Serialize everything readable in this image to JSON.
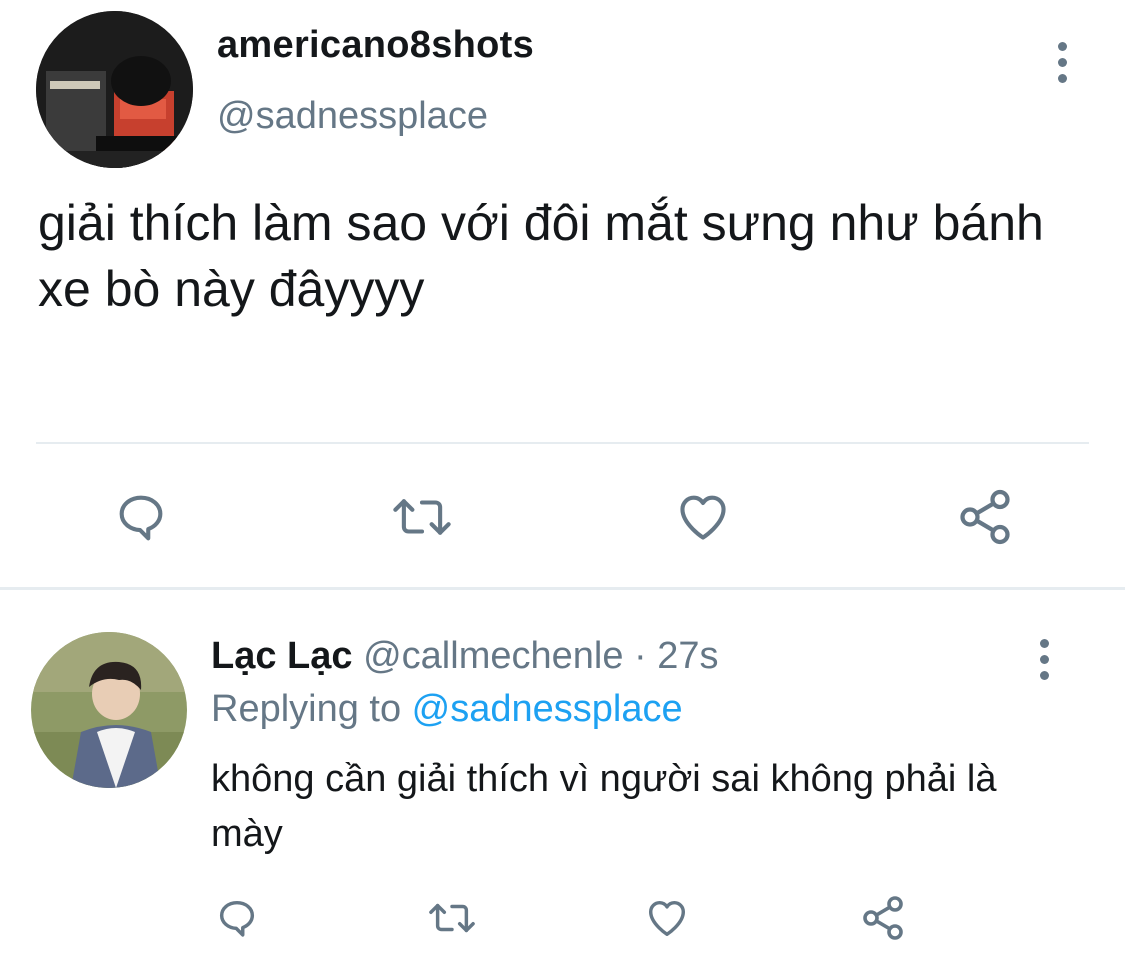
{
  "main_tweet": {
    "display_name": "americano8shots",
    "handle": "@sadnessplace",
    "text": "giải thích làm sao với đôi mắt sưng như bánh xe bò này đâyyyy",
    "actions": [
      "comment-icon",
      "retweet-icon",
      "heart-icon",
      "share-icon"
    ]
  },
  "reply_tweet": {
    "display_name": "Lạc Lạc",
    "handle": "@callmechenle",
    "separator": " · ",
    "time": "27s",
    "replying_prefix": "Replying to ",
    "replying_to": "@sadnessplace",
    "text": "không cần giải thích vì người sai không phải là mày",
    "actions": [
      "comment-icon",
      "retweet-icon",
      "heart-icon",
      "share-icon"
    ]
  },
  "colors": {
    "text_primary": "#14171a",
    "text_secondary": "#657786",
    "link_blue": "#1da1f2",
    "divider": "#e6ecf0"
  }
}
